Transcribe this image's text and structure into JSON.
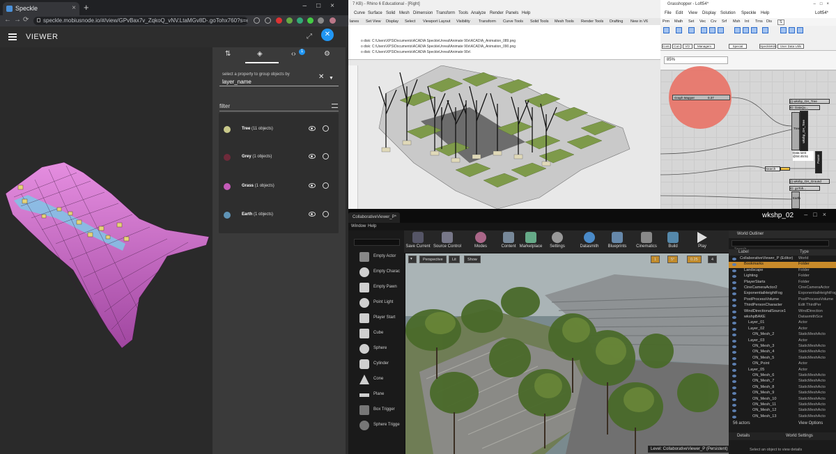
{
  "chrome": {
    "tab_title": "Speckle",
    "url": "speckle.mobiusnode.io/#/view/GPvBax7v_ZqkoQ_vNV.LtaMGv8D-.goTohx760?s=eyIzZXJZZXliOiJo..."
  },
  "speckle": {
    "app_title": "VIEWER",
    "notif_count": "1",
    "group_label": "select a property to group objects by",
    "group_value": "layer_name",
    "filter_placeholder": "filter",
    "layers": [
      {
        "name": "Tree",
        "count": "(11 objects)",
        "color": "#c9c98a"
      },
      {
        "name": "Grey",
        "count": "(1 objects)",
        "color": "#6e2a3a"
      },
      {
        "name": "Grass",
        "count": "(1 objects)",
        "color": "#c45bb8"
      },
      {
        "name": "Earth",
        "count": "(1 objects)",
        "color": "#5f93b5"
      }
    ]
  },
  "rhino": {
    "title": "7 KB) - Rhino 6 Educational - [Right]",
    "menu": [
      "Curve",
      "Surface",
      "Solid",
      "Mesh",
      "Dimension",
      "Transform",
      "Tools",
      "Analyze",
      "Render",
      "Panels",
      "Help"
    ],
    "tabs": [
      "lanes",
      "Set View",
      "Display",
      "Select",
      "Viewport Layout",
      "Visibility",
      "Transform",
      "Curve Tools",
      "Solid Tools",
      "Mesh Tools",
      "Render Tools",
      "Drafting",
      "New in V6"
    ],
    "log": [
      "o disk: C:\\Users\\XPS\\Documents\\ACADIA SpeckleUnreal\\Animate 90x\\ACADIA_Animation_089.png",
      "o disk: C:\\Users\\XPS\\Documents\\ACADIA SpeckleUnreal\\Animate 90x\\ACADIA_Animation_090.png",
      "o disk: C:\\Users\\XPS\\Documents\\ACADIA SpeckleUnreal\\Animate 90x\\"
    ]
  },
  "grasshopper": {
    "title": "Grasshopper - Loft54*",
    "doc": "Loft54*",
    "menu": [
      "File",
      "Edit",
      "View",
      "Display",
      "Solution",
      "Speckle",
      "Help"
    ],
    "tabs": [
      "Prm",
      "Math",
      "Set",
      "Vec",
      "Crv",
      "Srf",
      "Msh",
      "Int",
      "Trns",
      "Dis",
      "S"
    ],
    "groups": [
      "Cont.",
      "Con",
      "I/O",
      "Managem",
      "Special",
      "SpeckleKits",
      "User Data Utils"
    ],
    "zoom": "85%",
    "graph_mapper": "Graph Mapper",
    "graph_value": "0.37",
    "node_tree": "Tree",
    "node_search": "Search",
    "node_earth": "Earth",
    "data_label": "Data sent @04:45:51",
    "node_id1": "ID: DataQu...",
    "node_id2": "ID: goToh...",
    "node_wkshp_tree": "(i) wkshp_GH_Tree",
    "node_wkshp_ground": "(i) wkshp_GH_Ground",
    "sender_label": "wkshp_GH_Tree",
    "sender_btn": "Pause"
  },
  "unreal": {
    "tab": "CollaborativeViewer_P*",
    "level": "wkshp_02",
    "menu": [
      "Window",
      "Help"
    ],
    "toolbar": [
      "Save Current",
      "Source Control",
      "Modes",
      "Content",
      "Marketplace",
      "Settings",
      "Datasmith",
      "Blueprints",
      "Cinematics",
      "Build",
      "Play"
    ],
    "modes": [
      "Empty Actor",
      "Empty Charac",
      "Empty Pawn",
      "Point Light",
      "Player Start",
      "Cube",
      "Sphere",
      "Cylinder",
      "Cone",
      "Plane",
      "Box Trigger",
      "Sphere Trigge"
    ],
    "vp": {
      "perspective": "Perspective",
      "lit": "Lit",
      "show": "Show",
      "snap1": "1",
      "angle": "5°",
      "scale": "0.25",
      "cam": "4"
    },
    "level_label": "Level:  CollaborativeViewer_P (Persistent)",
    "outliner": {
      "title": "World Outliner",
      "search_placeholder": "Search...",
      "col_label": "Label",
      "col_type": "Type",
      "rows": [
        {
          "label": "CollaborativeViewer_P (Editor)",
          "type": "World",
          "indent": 0
        },
        {
          "label": "Bookmarks",
          "type": "Folder",
          "indent": 1
        },
        {
          "label": "Landscape",
          "type": "Folder",
          "indent": 1
        },
        {
          "label": "Lighting",
          "type": "Folder",
          "indent": 1
        },
        {
          "label": "PlayerStarts",
          "type": "Folder",
          "indent": 1
        },
        {
          "label": "CineCameraActor2",
          "type": "CineCameraActor",
          "indent": 1
        },
        {
          "label": "ExponentialHeightFog",
          "type": "ExponentialHeightFog",
          "indent": 1
        },
        {
          "label": "PostProcessVolume",
          "type": "PostProcessVolume",
          "indent": 1
        },
        {
          "label": "ThirdPersonCharacter",
          "type": "Edit ThirdPer",
          "indent": 1
        },
        {
          "label": "WindDirectionalSource1",
          "type": "WindDirection",
          "indent": 1
        },
        {
          "label": "wkshpBAKE",
          "type": "DatasmithSce",
          "indent": 1
        },
        {
          "label": "Layer_01",
          "type": "Actor",
          "indent": 2
        },
        {
          "label": "Layer_02",
          "type": "Actor",
          "indent": 2
        },
        {
          "label": "ON_Mesh_2",
          "type": "StaticMeshActo",
          "indent": 3
        },
        {
          "label": "Layer_03",
          "type": "Actor",
          "indent": 2
        },
        {
          "label": "ON_Mesh_3",
          "type": "StaticMeshActo",
          "indent": 3
        },
        {
          "label": "ON_Mesh_4",
          "type": "StaticMeshActo",
          "indent": 3
        },
        {
          "label": "ON_Mesh_5",
          "type": "StaticMeshActo",
          "indent": 3
        },
        {
          "label": "ON_Point",
          "type": "Actor",
          "indent": 3
        },
        {
          "label": "Layer_05",
          "type": "Actor",
          "indent": 2
        },
        {
          "label": "ON_Mesh_6",
          "type": "StaticMeshActo",
          "indent": 3
        },
        {
          "label": "ON_Mesh_7",
          "type": "StaticMeshActo",
          "indent": 3
        },
        {
          "label": "ON_Mesh_8",
          "type": "StaticMeshActo",
          "indent": 3
        },
        {
          "label": "ON_Mesh_9",
          "type": "StaticMeshActo",
          "indent": 3
        },
        {
          "label": "ON_Mesh_10",
          "type": "StaticMeshActo",
          "indent": 3
        },
        {
          "label": "ON_Mesh_11",
          "type": "StaticMeshActo",
          "indent": 3
        },
        {
          "label": "ON_Mesh_12",
          "type": "StaticMeshActo",
          "indent": 3
        },
        {
          "label": "ON_Mesh_13",
          "type": "StaticMeshActo",
          "indent": 3
        }
      ],
      "actor_count": "56 actors",
      "view_options": "View Options"
    },
    "details": {
      "details_tab": "Details",
      "settings_tab": "World Settings",
      "hint": "Select an object to view details"
    }
  }
}
